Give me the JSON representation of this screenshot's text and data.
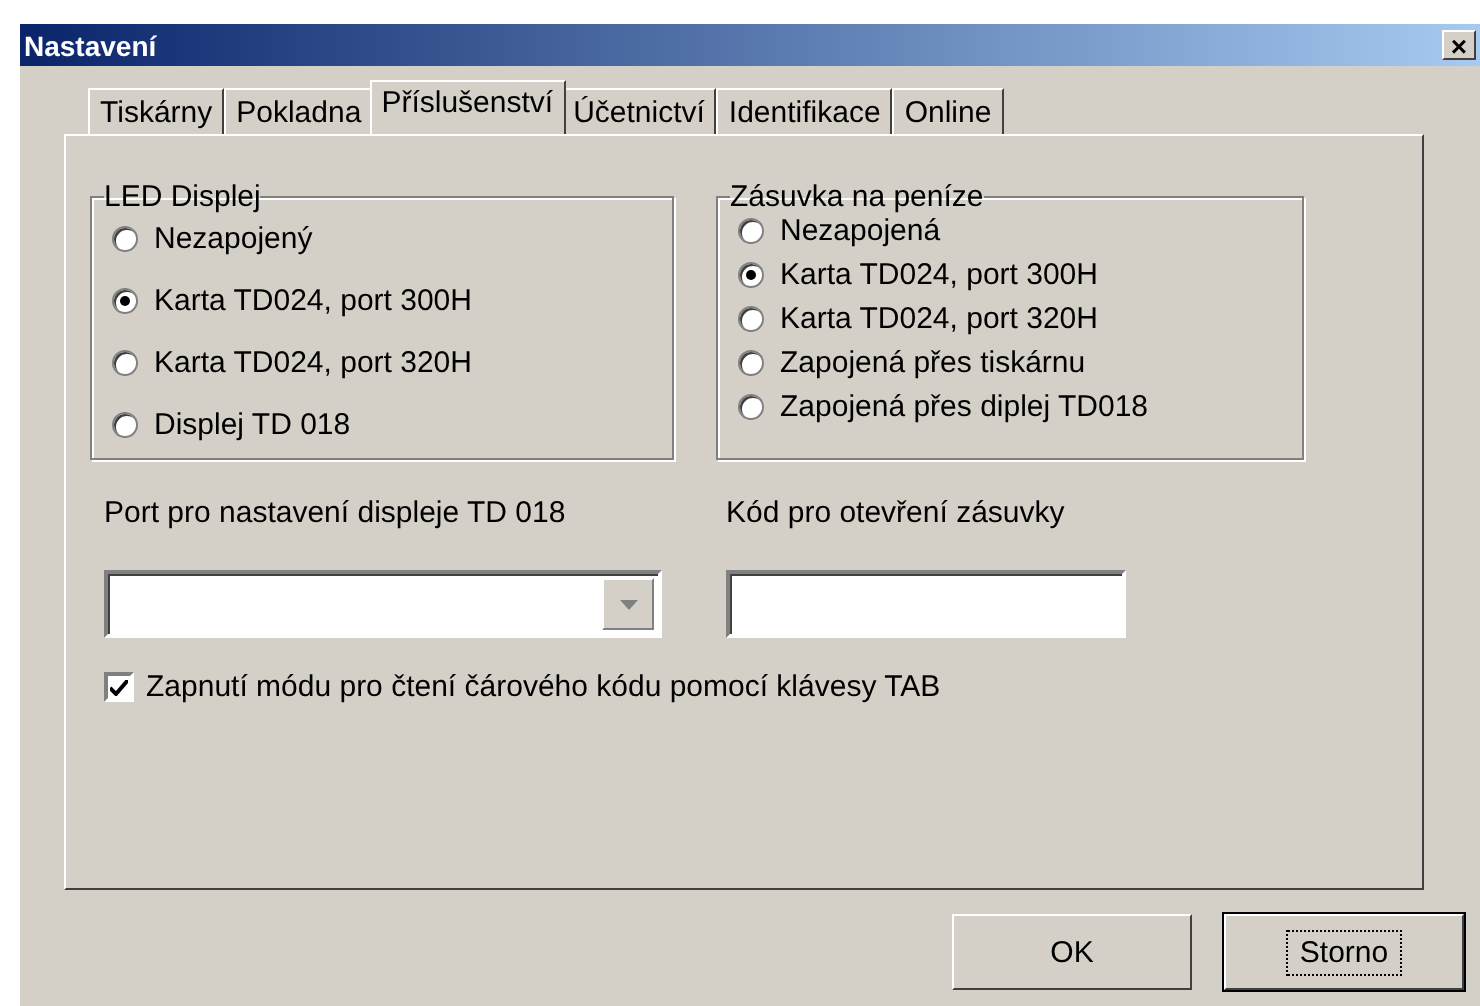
{
  "window": {
    "title": "Nastavení",
    "close": "×"
  },
  "tabs": [
    {
      "label": "Tiskárny",
      "selected": false
    },
    {
      "label": "Pokladna",
      "selected": false
    },
    {
      "label": "Příslušenství",
      "selected": true
    },
    {
      "label": "Účetnictví",
      "selected": false
    },
    {
      "label": "Identifikace",
      "selected": false
    },
    {
      "label": "Online",
      "selected": false
    }
  ],
  "groups": [
    {
      "title": "LED Displej",
      "options": [
        {
          "label": "Nezapojený",
          "selected": false
        },
        {
          "label": "Karta TD024, port 300H",
          "selected": true
        },
        {
          "label": "Karta TD024, port 320H",
          "selected": false
        },
        {
          "label": "Displej TD 018",
          "selected": false
        }
      ]
    },
    {
      "title": "Zásuvka na peníze",
      "options": [
        {
          "label": "Nezapojená",
          "selected": false
        },
        {
          "label": "Karta TD024, port 300H",
          "selected": true
        },
        {
          "label": "Karta TD024, port 320H",
          "selected": false
        },
        {
          "label": "Zapojená přes tiskárnu",
          "selected": false
        },
        {
          "label": "Zapojená přes diplej TD018",
          "selected": false
        }
      ]
    }
  ],
  "port_field": {
    "label": "Port pro nastavení displeje TD 018"
  },
  "code_field": {
    "label": "Kód pro otevření zásuvky"
  },
  "barcode_checkbox": {
    "label": "Zapnutí módu pro čtení čárového kódu pomocí klávesy TAB",
    "checked": true
  },
  "buttons": [
    {
      "label": "OK",
      "focused": false
    },
    {
      "label": "Storno",
      "focused": true
    }
  ]
}
